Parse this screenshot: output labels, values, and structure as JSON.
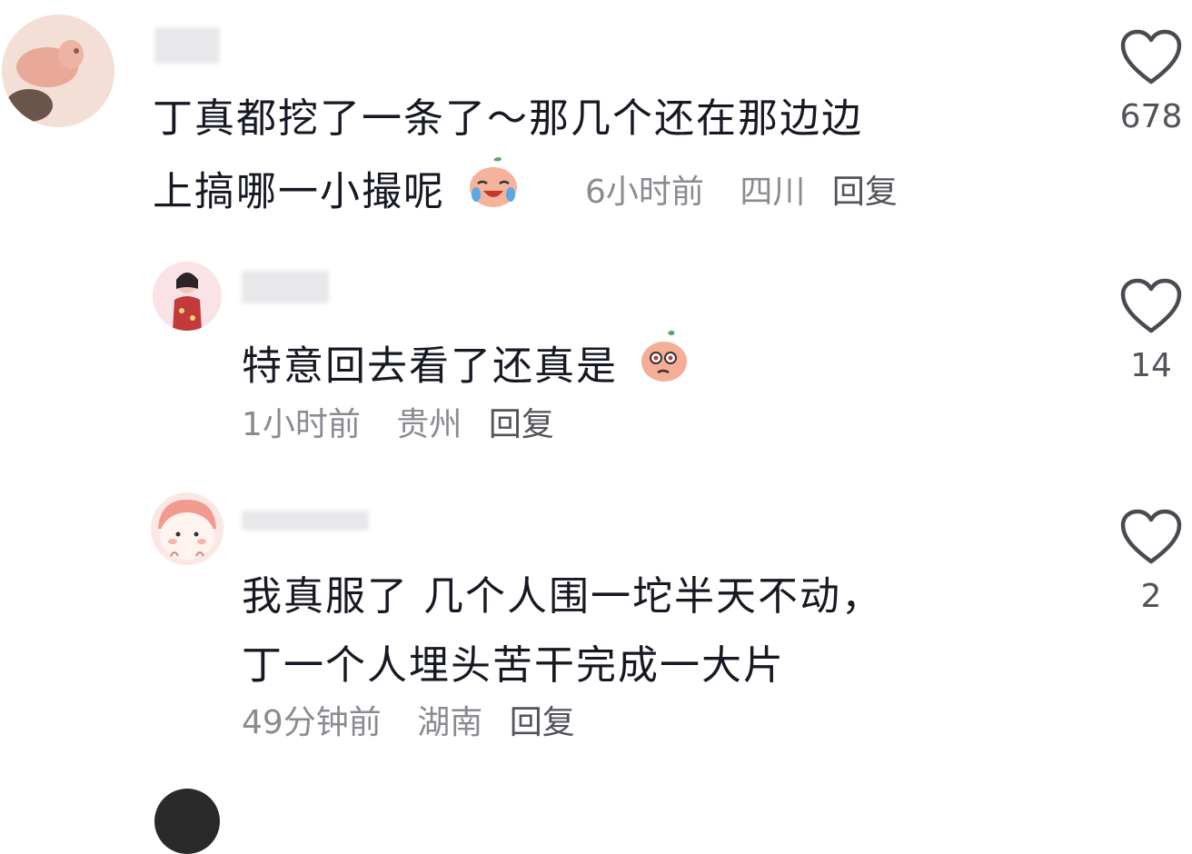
{
  "comments": [
    {
      "content_line1": "丁真都挖了一条了～那几个还在那边边",
      "content_line2": "上搞哪一小撮呢",
      "emoji": "crying-laughing-peach-emoji",
      "time": "6小时前",
      "location": "四川",
      "reply_label": "回复",
      "likes": "678"
    },
    {
      "content_line1": "特意回去看了还真是",
      "emoji": "shocked-peach-emoji",
      "time": "1小时前",
      "location": "贵州",
      "reply_label": "回复",
      "likes": "14"
    },
    {
      "content_line1": "我真服了 几个人围一坨半天不动，",
      "content_line2": "丁一个人埋头苦干完成一大片",
      "time": "49分钟前",
      "location": "湖南",
      "reply_label": "回复",
      "likes": "2"
    }
  ],
  "icons": {
    "like": "heart-outline-icon"
  },
  "colors": {
    "text": "#161823",
    "meta": "#8a8b91",
    "reply": "#52535b"
  }
}
